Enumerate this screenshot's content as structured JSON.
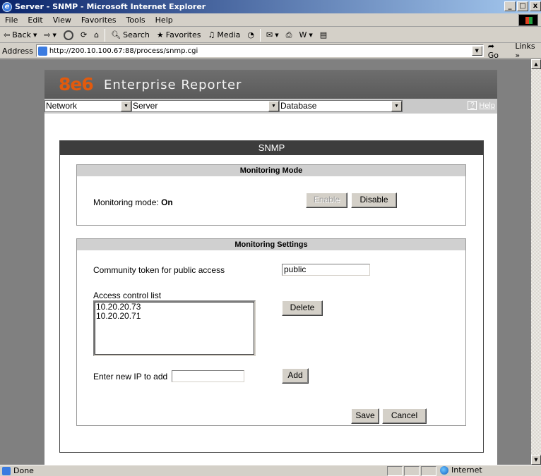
{
  "window": {
    "title": "Server - SNMP - Microsoft Internet Explorer",
    "controls": {
      "minimize": "_",
      "restore": "□",
      "close": "x"
    }
  },
  "menu": [
    "File",
    "Edit",
    "View",
    "Favorites",
    "Tools",
    "Help"
  ],
  "toolbar": {
    "back": "Back",
    "search": "Search",
    "favorites": "Favorites",
    "media": "Media"
  },
  "address": {
    "label": "Address",
    "url": "http://200.10.100.67:88/process/snmp.cgi",
    "go": "Go",
    "links": "Links"
  },
  "banner": {
    "logo": "8e6",
    "product": "Enterprise Reporter"
  },
  "nav": {
    "network": "Network",
    "server": "Server",
    "database": "Database",
    "help": "Help"
  },
  "panel": {
    "title": "SNMP",
    "monitoring_mode": {
      "title": "Monitoring Mode",
      "label": "Monitoring mode:",
      "value": "On",
      "enable_button": "Enable",
      "disable_button": "Disable"
    },
    "monitoring_settings": {
      "title": "Monitoring Settings",
      "community_label": "Community token for public access",
      "community_value": "public",
      "acl_label": "Access control list",
      "acl_items": [
        "10.20.20.73",
        "10.20.20.71"
      ],
      "delete_button": "Delete",
      "new_ip_label": "Enter new IP to add",
      "new_ip_value": "",
      "add_button": "Add",
      "save_button": "Save",
      "cancel_button": "Cancel"
    }
  },
  "status": {
    "text": "Done",
    "zone": "Internet"
  },
  "colors": {
    "logo_orange": "#e25a0d",
    "header_dark": "#3d3d3d",
    "section_header": "#d0d0d0"
  }
}
